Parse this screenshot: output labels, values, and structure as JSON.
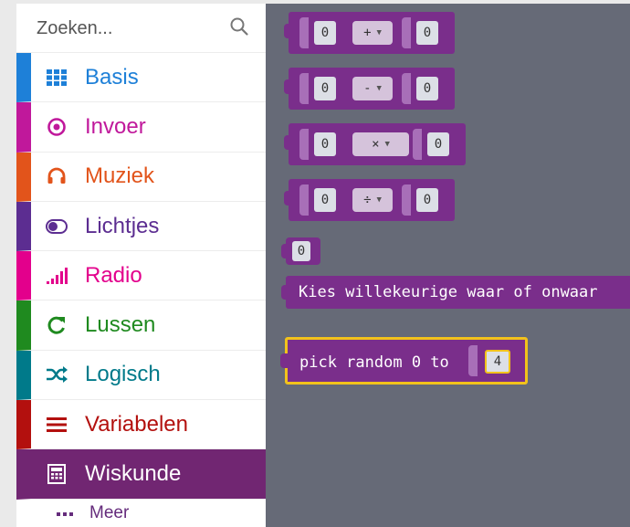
{
  "search": {
    "placeholder": "Zoeken..."
  },
  "categories": [
    {
      "label": "Basis",
      "color": "#1e80d8",
      "icon": "grid-icon"
    },
    {
      "label": "Invoer",
      "color": "#c0189b",
      "icon": "target-icon"
    },
    {
      "label": "Muziek",
      "color": "#e2541b",
      "icon": "headphones-icon"
    },
    {
      "label": "Lichtjes",
      "color": "#5c2d91",
      "icon": "toggle-icon"
    },
    {
      "label": "Radio",
      "color": "#e3008c",
      "icon": "signal-bars-icon"
    },
    {
      "label": "Lussen",
      "color": "#1f8a1f",
      "icon": "refresh-icon"
    },
    {
      "label": "Logisch",
      "color": "#007a8a",
      "icon": "shuffle-icon"
    },
    {
      "label": "Variabelen",
      "color": "#b3100e",
      "icon": "lines-icon"
    },
    {
      "label": "Wiskunde",
      "color": "#712672",
      "icon": "calculator-icon",
      "selected": true
    }
  ],
  "more": {
    "label": "Meer",
    "icon": "ellipsis-icon"
  },
  "blocks": {
    "add": {
      "left": "0",
      "op": "+",
      "right": "0"
    },
    "subtract": {
      "left": "0",
      "op": "-",
      "right": "0"
    },
    "multiply": {
      "left": "0",
      "op": "×",
      "right": "0"
    },
    "divide": {
      "left": "0",
      "op": "÷",
      "right": "0"
    },
    "number": {
      "value": "0"
    },
    "random_bool": {
      "label": "Kies willekeurige waar of onwaar"
    },
    "pick_random": {
      "label": "pick random 0 to",
      "value": "4"
    }
  },
  "colors": {
    "block": "#7a2e8b",
    "workspace": "#666a77",
    "highlight": "#f2c21b"
  }
}
